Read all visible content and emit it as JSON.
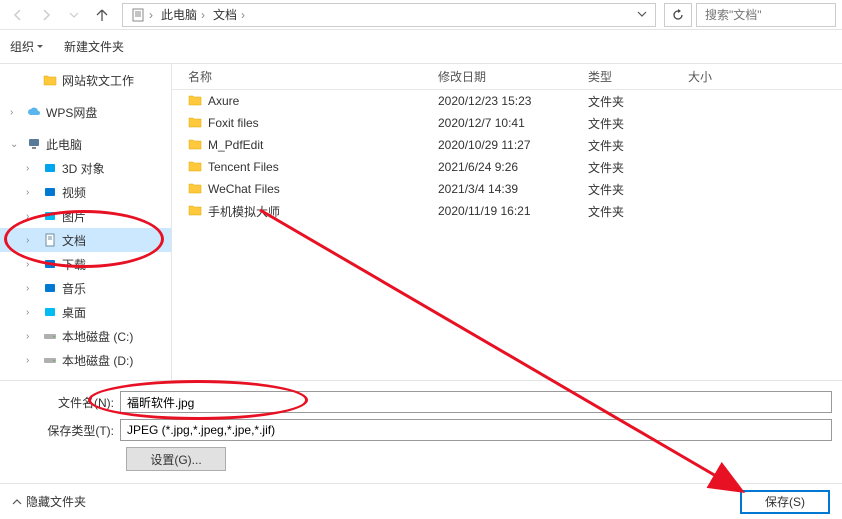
{
  "addressbar": {
    "root_icon": "document-icon",
    "segments": [
      "此电脑",
      "文档"
    ]
  },
  "search": {
    "placeholder": "搜索\"文档\""
  },
  "toolbar": {
    "organize": "组织",
    "new_folder": "新建文件夹"
  },
  "sidebar": {
    "top_folder": "网站软文工作",
    "wps": "WPS网盘",
    "this_pc": "此电脑",
    "items": [
      {
        "label": "3D 对象",
        "icon": "teal"
      },
      {
        "label": "视频",
        "icon": "blue"
      },
      {
        "label": "图片",
        "icon": "cyan"
      },
      {
        "label": "文档",
        "icon": "doc",
        "selected": true
      },
      {
        "label": "下载",
        "icon": "blue"
      },
      {
        "label": "音乐",
        "icon": "blue"
      },
      {
        "label": "桌面",
        "icon": "cyan"
      },
      {
        "label": "本地磁盘 (C:)",
        "icon": "drive"
      },
      {
        "label": "本地磁盘 (D:)",
        "icon": "drive"
      }
    ]
  },
  "filelist": {
    "columns": {
      "name": "名称",
      "date": "修改日期",
      "type": "类型",
      "size": "大小"
    },
    "rows": [
      {
        "name": "Axure",
        "date": "2020/12/23 15:23",
        "type": "文件夹"
      },
      {
        "name": "Foxit files",
        "date": "2020/12/7 10:41",
        "type": "文件夹"
      },
      {
        "name": "M_PdfEdit",
        "date": "2020/10/29 11:27",
        "type": "文件夹"
      },
      {
        "name": "Tencent Files",
        "date": "2021/6/24 9:26",
        "type": "文件夹"
      },
      {
        "name": "WeChat Files",
        "date": "2021/3/4 14:39",
        "type": "文件夹"
      },
      {
        "name": "手机模拟大师",
        "date": "2020/11/19 16:21",
        "type": "文件夹"
      }
    ]
  },
  "form": {
    "filename_label": "文件名(N):",
    "filename_value": "福昕软件.jpg",
    "filetype_label": "保存类型(T):",
    "filetype_value": "JPEG (*.jpg,*.jpeg,*.jpe,*.jif)",
    "settings_label": "设置(G)..."
  },
  "footer": {
    "hide_folders": "隐藏文件夹",
    "save": "保存(S)"
  }
}
